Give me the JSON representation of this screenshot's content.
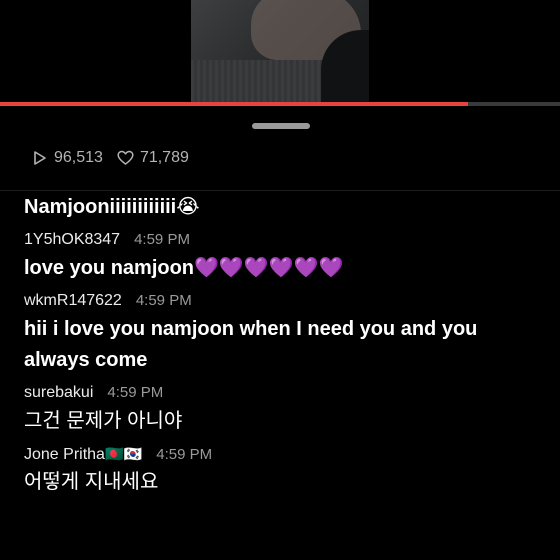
{
  "video": {
    "progress": 0.835
  },
  "stats": {
    "plays": "96,513",
    "likes": "71,789"
  },
  "comments": [
    {
      "user": "",
      "time": "",
      "text": "Namjooniiiiiiiiiiii😭"
    },
    {
      "user": "1Y5hOK8347",
      "time": "4:59 PM",
      "text": "love you namjoon💜💜💜💜💜💜"
    },
    {
      "user": "wkmR147622",
      "time": "4:59 PM",
      "text": "hii i love you namjoon when I need you and you always come"
    },
    {
      "user": "surebakui",
      "time": "4:59 PM",
      "text": "그건 문제가 아니야"
    },
    {
      "user": "Jone Pritha",
      "flags": "🇧🇩🇰🇷",
      "time": "4:59 PM",
      "text": "어떻게 지내세요"
    }
  ],
  "colors": {
    "accent": "#e8443f",
    "muted": "#9a9a9a"
  }
}
